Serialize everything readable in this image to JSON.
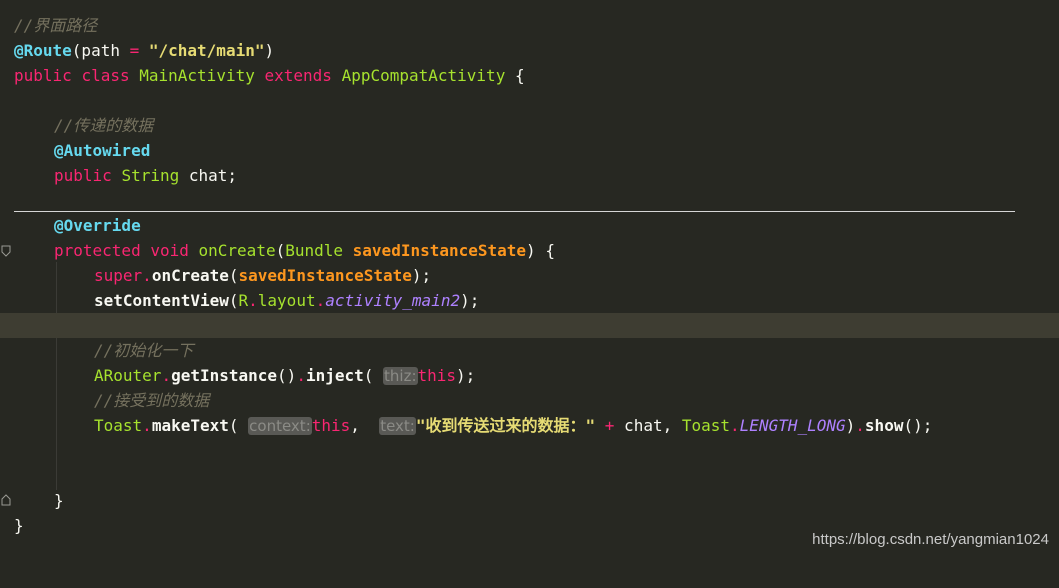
{
  "code": {
    "l1_comment": "//界面路径",
    "l2_annot": "@Route",
    "l2_open": "(path ",
    "l2_eq": "=",
    "l2_space": " ",
    "l2_str": "\"/chat/main\"",
    "l2_close": ")",
    "l3_public": "public",
    "l3_class": "class",
    "l3_name": "MainActivity",
    "l3_extends": "extends",
    "l3_super": "AppCompatActivity",
    "l3_brace": " {",
    "l5_comment": "//传递的数据",
    "l6_annot": "@Autowired",
    "l7_public": "public",
    "l7_type": "String",
    "l7_rest": " chat;",
    "l9_annot": "@Override",
    "l10_protected": "protected",
    "l10_void": "void",
    "l10_method": "onCreate",
    "l10_open": "(",
    "l10_type": "Bundle",
    "l10_param": "savedInstanceState",
    "l10_close": ") {",
    "l11_super": "super",
    "l11_dot": ".",
    "l11_method": "onCreate",
    "l11_open": "(",
    "l11_param": "savedInstanceState",
    "l11_close": ");",
    "l12_method": "setContentView",
    "l12_open": "(",
    "l12_R": "R",
    "l12_dot1": ".",
    "l12_layout": "layout",
    "l12_dot2": ".",
    "l12_field": "activity_main2",
    "l12_close": ");",
    "l14_comment": "//初始化一下",
    "l15_cls": "ARouter",
    "l15_dot1": ".",
    "l15_m1": "getInstance",
    "l15_paren": "()",
    "l15_dot2": ".",
    "l15_m2": "inject",
    "l15_open": "(",
    "l15_hint": "thiz:",
    "l15_this": "this",
    "l15_close": ");",
    "l16_comment": "//接受到的数据",
    "l17_cls": "Toast",
    "l17_dot1": ".",
    "l17_m1": "makeText",
    "l17_open": "(",
    "l17_hint1": "context:",
    "l17_this": "this",
    "l17_comma": ", ",
    "l17_hint2": "text:",
    "l17_str": "\"收到传送过来的数据：\"",
    "l17_plus": "+",
    "l17_chat": " chat, ",
    "l17_cls2": "Toast",
    "l17_dot2": ".",
    "l17_const": "LENGTH_LONG",
    "l17_close": ")",
    "l17_dot3": ".",
    "l17_show": "show",
    "l17_end": "();",
    "l20_brace": "}",
    "l21_brace": "}"
  },
  "watermark": "https://blog.csdn.net/yangmian1024",
  "colors": {
    "background": "#272822",
    "current_line": "#3e3d32",
    "keyword": "#f92672",
    "annotation": "#66d9ef",
    "string": "#e6db74",
    "class": "#a6e22e",
    "param": "#fd971f",
    "comment": "#75715e",
    "constant": "#ae81ff"
  },
  "icons": [
    "fold-start-icon",
    "fold-end-icon"
  ]
}
